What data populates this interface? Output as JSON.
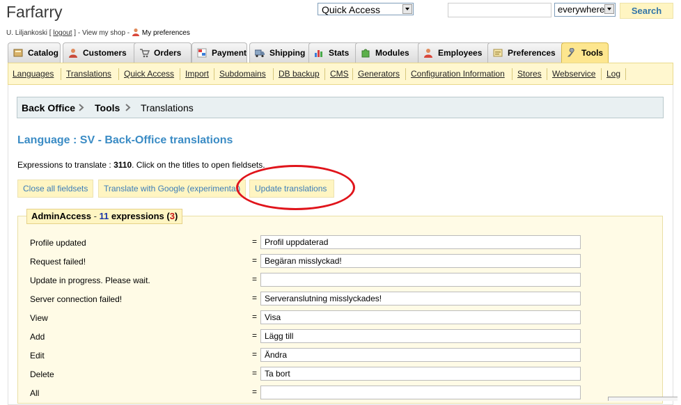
{
  "header": {
    "shop_name": "Farfarry",
    "user_name": "U. Liljankoski",
    "bracket_open": " [ ",
    "logout": "logout",
    "bracket_close": " ] - View my shop - ",
    "preferences": "My preferences",
    "quick_access": "Quick Access",
    "search_value": "",
    "search_scope": "everywhere",
    "search_button": "Search"
  },
  "tabs": [
    {
      "label": "Catalog",
      "icon": "catalog-icon"
    },
    {
      "label": "Customers",
      "icon": "customers-icon"
    },
    {
      "label": "Orders",
      "icon": "cart-icon"
    },
    {
      "label": "Payment",
      "icon": "payment-icon"
    },
    {
      "label": "Shipping",
      "icon": "truck-icon"
    },
    {
      "label": "Stats",
      "icon": "bar-chart-icon"
    },
    {
      "label": "Modules",
      "icon": "puzzle-icon"
    },
    {
      "label": "Employees",
      "icon": "person-icon"
    },
    {
      "label": "Preferences",
      "icon": "preferences-icon"
    },
    {
      "label": "Tools",
      "icon": "wrench-icon",
      "active": true
    }
  ],
  "subnav": [
    "Languages",
    "Translations",
    "Quick Access",
    "Import",
    "Subdomains",
    "DB backup",
    "CMS",
    "Generators",
    "Configuration Information",
    "Stores",
    "Webservice",
    "Log"
  ],
  "breadcrumb": [
    "Back Office",
    "Tools",
    "Translations"
  ],
  "page_title": "Language : SV - Back-Office translations",
  "expressions": {
    "prefix": "Expressions to translate : ",
    "count": "3110",
    "suffix": ". Click on the titles to open fieldsets."
  },
  "buttons": {
    "close_all": "Close all fieldsets",
    "translate_google": "Translate with Google (experimental)",
    "update": "Update translations"
  },
  "fieldset": {
    "name": "AdminAccess",
    "dash": " - ",
    "count": "11",
    "expr_word": " expressions (",
    "missing": "3",
    "close_paren": ")"
  },
  "rows": [
    {
      "label": "Profile updated",
      "value": "Profil uppdaterad"
    },
    {
      "label": "Request failed!",
      "value": "Begäran misslyckad!"
    },
    {
      "label": "Update in progress. Please wait.",
      "value": ""
    },
    {
      "label": "Server connection failed!",
      "value": "Serveranslutning misslyckades!"
    },
    {
      "label": "View",
      "value": "Visa"
    },
    {
      "label": "Add",
      "value": "Lägg till"
    },
    {
      "label": "Edit",
      "value": "Ändra"
    },
    {
      "label": "Delete",
      "value": "Ta bort"
    },
    {
      "label": "All",
      "value": ""
    }
  ],
  "equals_sign": "=",
  "colors": {
    "accent": "#3b8cc5",
    "active_tab": "#fde68f",
    "highlight": "#e0141b"
  }
}
